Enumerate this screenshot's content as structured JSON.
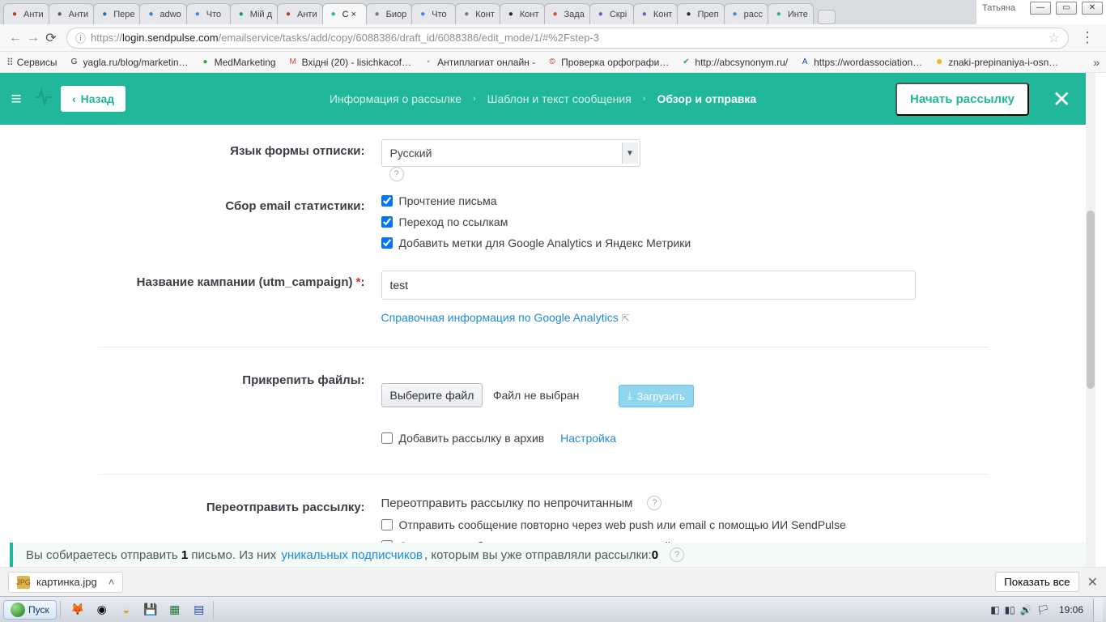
{
  "win": {
    "user": "Татьяна"
  },
  "tabs": [
    {
      "label": "Анти",
      "iconColor": "#c2352b"
    },
    {
      "label": "Анти",
      "iconColor": "#5a5a5a"
    },
    {
      "label": "Пере",
      "iconColor": "#1a6fbf"
    },
    {
      "label": "adwo",
      "iconColor": "#2c82c9"
    },
    {
      "label": "Что",
      "iconColor": "#4285f4"
    },
    {
      "label": "Мій д",
      "iconColor": "#0f9d58"
    },
    {
      "label": "Анти",
      "iconColor": "#c2352b"
    },
    {
      "label": "С  ×",
      "iconColor": "#20b79a",
      "active": true
    },
    {
      "label": "Биор",
      "iconColor": "#7a7a7a"
    },
    {
      "label": "Что",
      "iconColor": "#4285f4"
    },
    {
      "label": "Конт",
      "iconColor": "#7a7a7a"
    },
    {
      "label": "Конт",
      "iconColor": "#2c2c2c"
    },
    {
      "label": "Зада",
      "iconColor": "#d04a3a"
    },
    {
      "label": "Скрі",
      "iconColor": "#7a52c7"
    },
    {
      "label": "Конт",
      "iconColor": "#7a52c7"
    },
    {
      "label": "Преп",
      "iconColor": "#2c2c2c"
    },
    {
      "label": "расс",
      "iconColor": "#4285f4"
    },
    {
      "label": "Инте",
      "iconColor": "#20b79a"
    }
  ],
  "omnibox": {
    "proto": "https://",
    "host": "login.sendpulse.com",
    "path": "/emailservice/tasks/add/copy/6088386/draft_id/6088386/edit_mode/1/#%2Fstep-3"
  },
  "bookmarks": [
    {
      "icon": "⦿",
      "label": "Сервисы"
    },
    {
      "icon": "G",
      "label": "yagla.ru/blog/marketin…"
    },
    {
      "icon": "●",
      "label": "MedMarketing",
      "color": "#2aa84a"
    },
    {
      "icon": "M",
      "label": "Вхідні (20) - lisichkacof…",
      "color": "#d04a3a"
    },
    {
      "icon": "◦",
      "label": "Антиплагиат онлайн -"
    },
    {
      "icon": "©",
      "label": "Проверка орфографи…",
      "color": "#c2352b"
    },
    {
      "icon": "✔",
      "label": "http://abcsynonym.ru/",
      "color": "#2aa84a"
    },
    {
      "icon": "A",
      "label": "https://wordassociation…",
      "color": "#0b3ea8"
    },
    {
      "icon": "☻",
      "label": "znaki-prepinaniya-i-osn…",
      "color": "#f2b200"
    }
  ],
  "app": {
    "back": "Назад",
    "bc1": "Информация о рассылке",
    "bc2": "Шаблон и текст сообщения",
    "bc3": "Обзор и отправка",
    "primary": "Начать рассылку",
    "lang_label": "Язык формы отписки:",
    "lang_value": "Русский",
    "stats_label": "Сбор email статистики:",
    "stats_opt1": "Прочтение письма",
    "stats_opt2": "Переход по ссылкам",
    "stats_opt3": "Добавить метки для Google Analytics и Яндекс Метрики",
    "utm_label": "Название кампании (utm_campaign) ",
    "utm_value": "test",
    "ga_link": "Справочная информация по Google Analytics",
    "attach_label": "Прикрепить файлы:",
    "file_btn": "Выберите файл",
    "file_state": "Файл не выбран",
    "upload_btn": "Загрузить",
    "archive_opt": "Добавить рассылку в архив",
    "archive_link": "Настройка",
    "resend_label": "Переотправить рассылку:",
    "resend_title": "Переотправить рассылку по непрочитанным",
    "resend_opt1": "Отправить сообщение повторно через web push или email с помощью ИИ SendPulse",
    "resend_opt2": "Отправить сообщение повторно только через email",
    "notice_prefix": "Вы собираетесь отправить ",
    "notice_count": "1",
    "notice_mid": " письмо. Из них ",
    "notice_link": "уникальных подписчиков",
    "notice_suffix_a": ", которым вы уже отправляли рассылки: ",
    "notice_suffix_n": "0"
  },
  "download": {
    "file": "картинка.jpg",
    "showall": "Показать все"
  },
  "taskbar": {
    "start": "Пуск",
    "clock": "19:06"
  }
}
